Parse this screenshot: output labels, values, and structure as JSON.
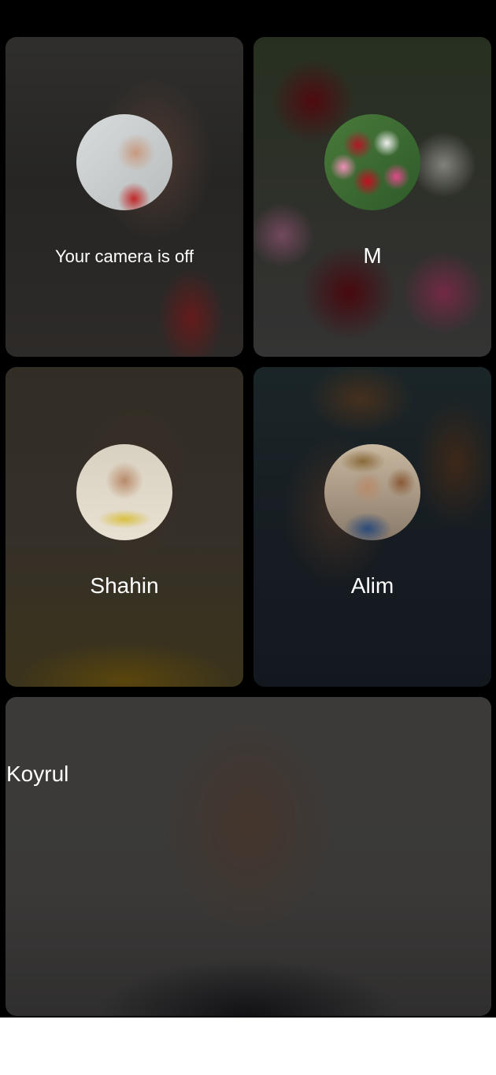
{
  "participants": [
    {
      "name": "Your camera is off",
      "avatar_initial": "",
      "role": "self"
    },
    {
      "name": "M",
      "avatar_initial": ""
    },
    {
      "name": "Shahin",
      "avatar_initial": ""
    },
    {
      "name": "Alim",
      "avatar_initial": ""
    },
    {
      "name": "Koyrul",
      "avatar_initial": ""
    }
  ]
}
